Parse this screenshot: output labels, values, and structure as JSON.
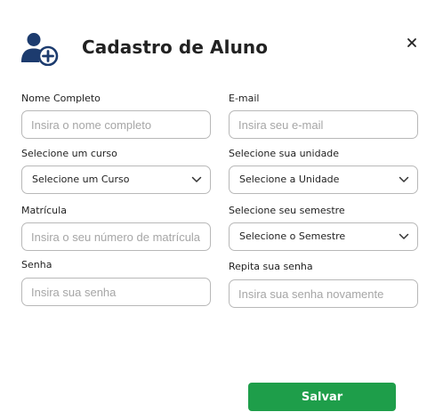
{
  "dialog": {
    "title": "Cadastro de Aluno",
    "close_symbol": "×",
    "header_icon": "user-add-icon",
    "accent_color": "#1c3b6e",
    "primary_color": "#1e9e4a"
  },
  "form": {
    "name": {
      "label": "Nome Completo",
      "placeholder": "Insira o nome completo",
      "value": ""
    },
    "email": {
      "label": "E-mail",
      "placeholder": "Insira seu e-mail",
      "value": ""
    },
    "course": {
      "label": "Selecione um curso",
      "selected": "Selecione um Curso",
      "icon": "chevron-down-icon"
    },
    "unit": {
      "label": "Selecione sua unidade",
      "selected": "Selecione a Unidade",
      "icon": "chevron-down-icon"
    },
    "registration": {
      "label": "Matrícula",
      "placeholder": "Insira o seu número de matrícula",
      "value": ""
    },
    "semester": {
      "label": "Selecione seu semestre",
      "selected": "Selecione o Semestre",
      "icon": "chevron-down-icon"
    },
    "password": {
      "label": "Senha",
      "placeholder": "Insira sua senha",
      "value": ""
    },
    "password_repeat": {
      "label": "Repita sua senha",
      "placeholder": "Insira sua senha novamente",
      "value": ""
    }
  },
  "actions": {
    "save_label": "Salvar"
  }
}
